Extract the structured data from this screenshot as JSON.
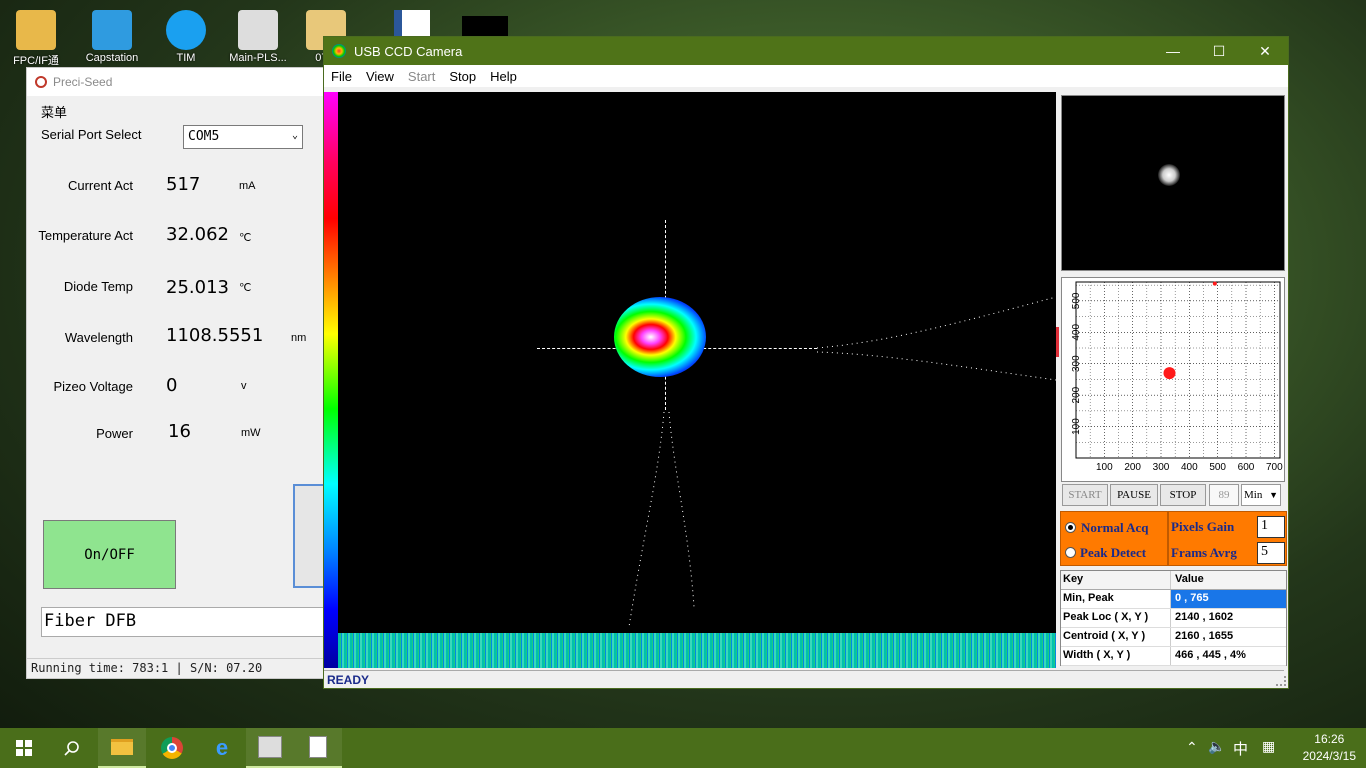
{
  "desktop": {
    "icons": [
      {
        "label": "FPC/IF通"
      },
      {
        "label": "Capstation"
      },
      {
        "label": "TIM"
      },
      {
        "label": "Main-PLS..."
      },
      {
        "label": "07..."
      }
    ]
  },
  "preci_seed": {
    "title": "Preci-Seed",
    "menu": "菜单",
    "serial_port_label": "Serial Port Select",
    "serial_port_value": "COM5",
    "rows": [
      {
        "label": "Current Act",
        "value": "517",
        "unit": "mA"
      },
      {
        "label": "Temperature Act",
        "value": "32.062",
        "unit": "℃"
      },
      {
        "label": "Diode Temp",
        "value": "25.013",
        "unit": "℃"
      },
      {
        "label": "Wavelength",
        "value": "1108.5551",
        "unit": "nm"
      },
      {
        "label": "Pizeo Voltage",
        "value": "0",
        "unit": "v"
      },
      {
        "label": "Power",
        "value": "16",
        "unit": "mW"
      }
    ],
    "onoff_label": "On/OFF",
    "fiber_label": "Fiber DFB",
    "status_text": "Running time: 783:1 | S/N: 07.20"
  },
  "camera": {
    "title": "USB CCD Camera",
    "menu": [
      "File",
      "View",
      "Start",
      "Stop",
      "Help"
    ],
    "status": "READY",
    "plot": {
      "x_ticks": [
        "100",
        "200",
        "300",
        "400",
        "500",
        "600",
        "700"
      ],
      "y_ticks": [
        "500",
        "400",
        "300",
        "200",
        "100"
      ],
      "x_range": [
        0,
        720
      ],
      "y_range": [
        0,
        560
      ],
      "marker": {
        "x": 330,
        "y": 270
      },
      "top_marker": {
        "x": 490,
        "y": 555
      }
    },
    "buttons": {
      "start": "START",
      "pause": "PAUSE",
      "stop": "STOP"
    },
    "value_box": "89",
    "unit_select": "Min",
    "acq": {
      "normal": "Normal Acq",
      "peak": "Peak Detect"
    },
    "gain": {
      "label": "Pixels Gain",
      "value": "1"
    },
    "avg": {
      "label": "Frams Avrg",
      "value": "5"
    },
    "table": {
      "headers": [
        "Key",
        "Value"
      ],
      "rows": [
        {
          "key": "Min, Peak",
          "value": "0 , 765"
        },
        {
          "key": "Peak Loc ( X, Y )",
          "value": "2140 , 1602"
        },
        {
          "key": "Centroid ( X, Y )",
          "value": "2160 , 1655"
        },
        {
          "key": "Width ( X, Y )",
          "value": "466 , 445 , 4%"
        }
      ]
    }
  },
  "taskbar": {
    "ime": "中",
    "time": "16:26",
    "date": "2024/3/15"
  }
}
